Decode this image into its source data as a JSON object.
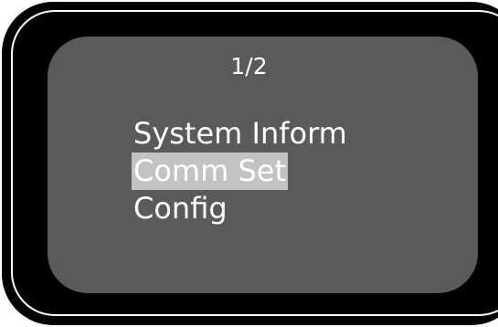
{
  "screen": {
    "page_indicator": "1/2",
    "menu": {
      "items": [
        {
          "label": "System Inform",
          "selected": false
        },
        {
          "label": "Comm Set",
          "selected": true
        },
        {
          "label": "Config",
          "selected": false
        }
      ],
      "selected_color": "#c3c3c3"
    },
    "colors": {
      "bezel": "#000000",
      "screen": "#5a5a5a",
      "text": "#ffffff"
    }
  }
}
